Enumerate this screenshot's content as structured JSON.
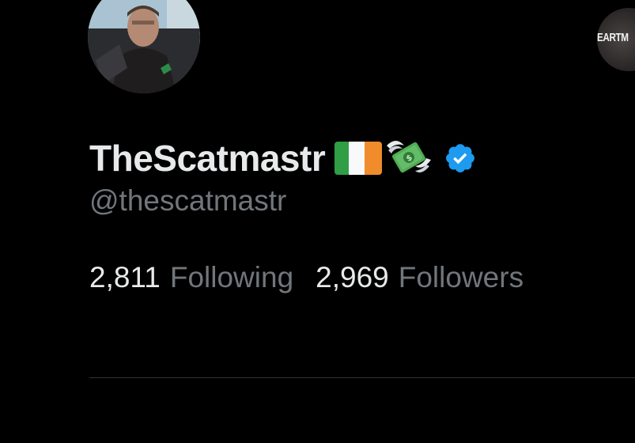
{
  "profile": {
    "display_name": "TheScatmastr",
    "handle": "@thescatmastr",
    "badges": [
      "flag-ireland-icon",
      "money-with-wings-icon",
      "verified-badge-icon"
    ],
    "verified_color": "#1d9bf0",
    "stats": {
      "following_count": "2,811",
      "following_label": "Following",
      "followers_count": "2,969",
      "followers_label": "Followers"
    }
  },
  "side_avatar": {
    "text": "EARTM"
  },
  "colors": {
    "background": "#000000",
    "primary_text": "#e7e9ea",
    "secondary_text": "#71767b",
    "divider": "#2f3336"
  }
}
